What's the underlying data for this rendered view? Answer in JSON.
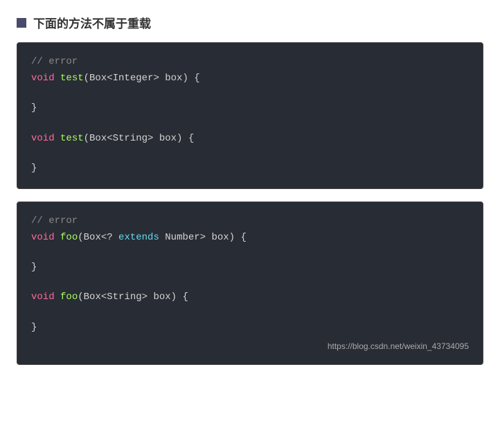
{
  "header": {
    "icon_color": "#4a4a6a",
    "title": "下面的方法不属于重载"
  },
  "code_blocks": [
    {
      "id": "block1",
      "lines": [
        {
          "type": "comment",
          "text": "// error"
        },
        {
          "type": "code",
          "parts": [
            {
              "cls": "kw-void",
              "text": "void"
            },
            {
              "cls": "plain",
              "text": " "
            },
            {
              "cls": "fn-name",
              "text": "test"
            },
            {
              "cls": "plain",
              "text": "(Box<Integer> box) {"
            }
          ]
        },
        {
          "type": "empty"
        },
        {
          "type": "code",
          "parts": [
            {
              "cls": "plain",
              "text": "}"
            }
          ]
        },
        {
          "type": "empty"
        },
        {
          "type": "code",
          "parts": [
            {
              "cls": "kw-void",
              "text": "void"
            },
            {
              "cls": "plain",
              "text": " "
            },
            {
              "cls": "fn-name",
              "text": "test"
            },
            {
              "cls": "plain",
              "text": "(Box<String> box) {"
            }
          ]
        },
        {
          "type": "empty"
        },
        {
          "type": "code",
          "parts": [
            {
              "cls": "plain",
              "text": "}"
            }
          ]
        }
      ]
    },
    {
      "id": "block2",
      "lines": [
        {
          "type": "comment",
          "text": "// error"
        },
        {
          "type": "code",
          "parts": [
            {
              "cls": "kw-void",
              "text": "void"
            },
            {
              "cls": "plain",
              "text": " "
            },
            {
              "cls": "fn-name",
              "text": "foo"
            },
            {
              "cls": "plain",
              "text": "(Box<? "
            },
            {
              "cls": "kw-extends",
              "text": "extends"
            },
            {
              "cls": "plain",
              "text": " Number> box) {"
            }
          ]
        },
        {
          "type": "empty"
        },
        {
          "type": "code",
          "parts": [
            {
              "cls": "plain",
              "text": "}"
            }
          ]
        },
        {
          "type": "empty"
        },
        {
          "type": "code",
          "parts": [
            {
              "cls": "kw-void",
              "text": "void"
            },
            {
              "cls": "plain",
              "text": " "
            },
            {
              "cls": "fn-name",
              "text": "foo"
            },
            {
              "cls": "plain",
              "text": "(Box<String> box) {"
            }
          ]
        },
        {
          "type": "empty"
        },
        {
          "type": "code",
          "parts": [
            {
              "cls": "plain",
              "text": "}"
            }
          ]
        }
      ],
      "watermark": "https://blog.csdn.net/weixin_43734095"
    }
  ]
}
